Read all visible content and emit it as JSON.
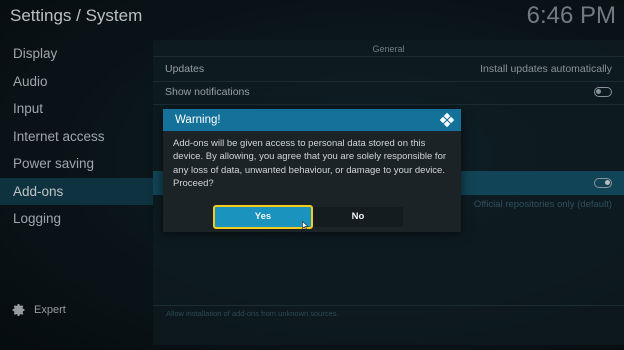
{
  "header": {
    "title": "Settings / System",
    "clock": "6:46 PM"
  },
  "sidebar": {
    "items": [
      {
        "label": "Display"
      },
      {
        "label": "Audio"
      },
      {
        "label": "Input"
      },
      {
        "label": "Internet access"
      },
      {
        "label": "Power saving"
      },
      {
        "label": "Add-ons"
      },
      {
        "label": "Logging"
      }
    ],
    "active": "Add-ons",
    "expert_label": "Expert"
  },
  "main": {
    "section": "General",
    "updates_label": "Updates",
    "updates_value": "Install updates automatically",
    "notifications_label": "Show notifications",
    "repo_value": "Official repositories only (default)",
    "footer_desc": "Allow installation of add-ons from unknown sources."
  },
  "dialog": {
    "title": "Warning!",
    "message": "Add-ons will be given access to personal data stored on this device. By allowing, you agree that you are solely responsible for any loss of data, unwanted behaviour, or damage to your device. Proceed?",
    "yes_label": "Yes",
    "no_label": "No"
  },
  "colors": {
    "accent": "#13719a",
    "focus_border": "#f2cb1d",
    "selected_row": "#123e4f"
  }
}
